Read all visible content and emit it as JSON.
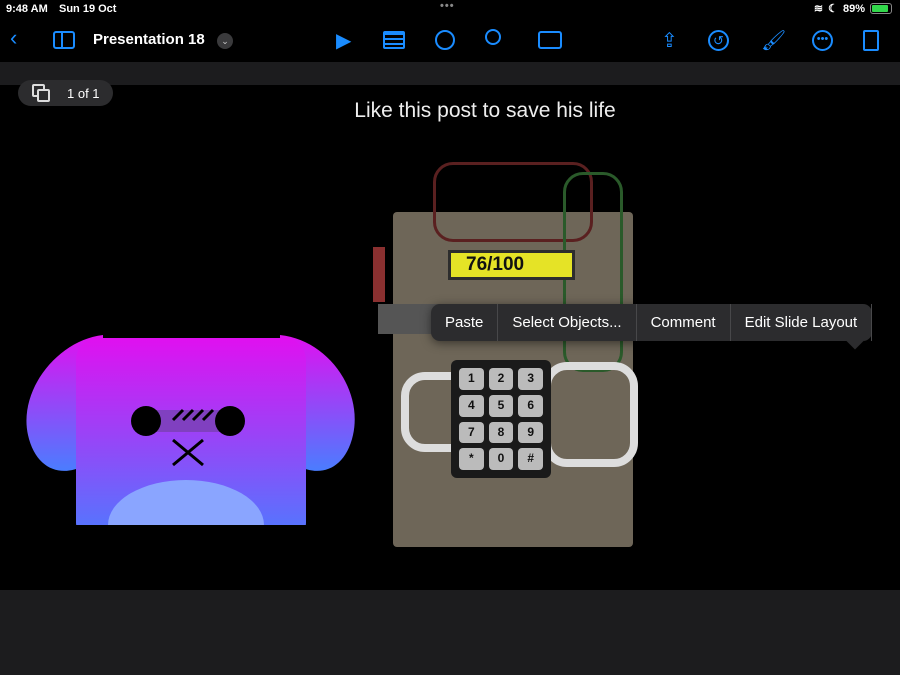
{
  "status": {
    "time": "9:48 AM",
    "date": "Sun 19 Oct",
    "battery": "89%",
    "battery_level": 0.89
  },
  "toolbar": {
    "title": "Presentation 18",
    "icons": [
      "back-icon",
      "sidebar-icon",
      "play-icon",
      "table-icon",
      "chart-icon",
      "shapes-icon",
      "media-icon",
      "share-icon",
      "undo-icon",
      "format-brush-icon",
      "more-icon",
      "reader-view-icon"
    ]
  },
  "pager": {
    "label": "1 of 1"
  },
  "slide": {
    "title": "Like this post to save his life",
    "counter": "76/100",
    "keys": [
      "1",
      "2",
      "3",
      "4",
      "5",
      "6",
      "7",
      "8",
      "9",
      "*",
      "0",
      "#"
    ]
  },
  "context_menu": {
    "items": [
      "Paste",
      "Select Objects...",
      "Comment",
      "Edit Slide Layout"
    ]
  },
  "colors": {
    "accent": "#1a8cff",
    "dog_top": "#e010f0",
    "dog_bottom": "#4a7dff"
  }
}
